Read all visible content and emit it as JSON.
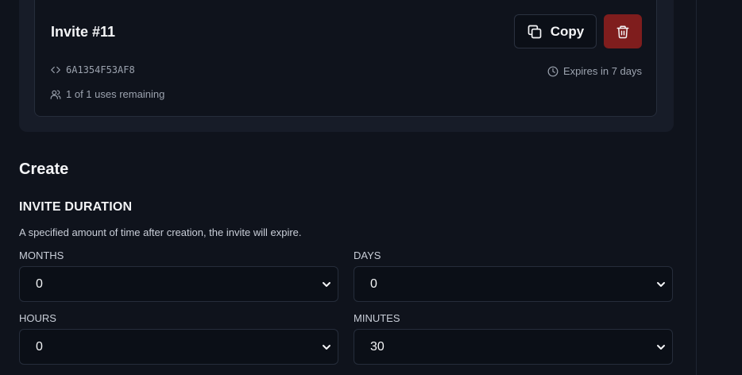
{
  "invite": {
    "title": "Invite #11",
    "copy_label": "Copy",
    "code": "6A1354F53AF8",
    "uses": "1 of 1 uses remaining",
    "expires": "Expires in 7 days"
  },
  "create": {
    "title": "Create",
    "duration_title": "INVITE DURATION",
    "description": "A specified amount of time after creation, the invite will expire.",
    "fields": {
      "months": {
        "label": "MONTHS",
        "value": "0"
      },
      "days": {
        "label": "DAYS",
        "value": "0"
      },
      "hours": {
        "label": "HOURS",
        "value": "0"
      },
      "minutes": {
        "label": "MINUTES",
        "value": "30"
      }
    }
  },
  "colors": {
    "background": "#0f131c",
    "panel": "#171c28",
    "delete": "#7f1d1d"
  }
}
